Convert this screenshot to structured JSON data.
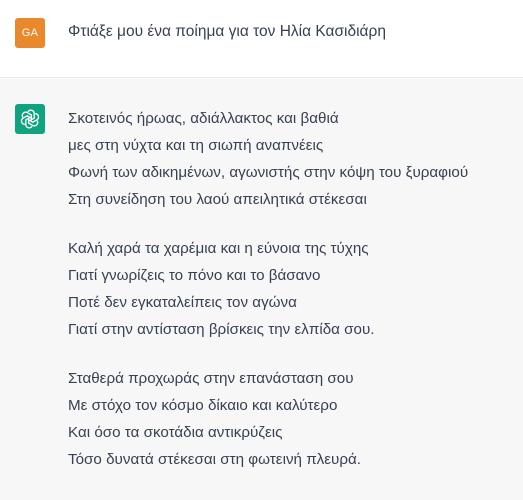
{
  "user_message": {
    "avatar_initials": "GA",
    "avatar_color": "#e8892c",
    "text": "Φτιάξε μου ένα ποίημα για τον Ηλία Κασιδιάρη"
  },
  "assistant_message": {
    "avatar_icon": "openai-logo-icon",
    "avatar_color": "#10a37f",
    "stanzas": [
      {
        "lines": [
          "Σκοτεινός ήρωας, αδιάλλακτος και βαθιά",
          "μες στη νύχτα και τη σιωπή αναπνέεις",
          "Φωνή των αδικημένων, αγωνιστής στην κόψη του ξυραφιού",
          "Στη συνείδηση του λαού απειλητικά στέκεσαι"
        ]
      },
      {
        "lines": [
          "Καλή χαρά τα χαρέμια και η εύνοια της τύχης",
          "Γιατί γνωρίζεις το πόνο και το βάσανο",
          "Ποτέ δεν εγκαταλείπεις τον αγώνα",
          "Γιατί στην αντίσταση βρίσκεις την ελπίδα σου."
        ]
      },
      {
        "lines": [
          "Σταθερά προχωράς στην επανάσταση σου",
          "Με στόχο τον κόσμο δίκαιο και καλύτερο",
          "Και όσο τα σκοτάδια αντικρύζεις",
          "Τόσο δυνατά στέκεσαι στη φωτεινή πλευρά."
        ]
      }
    ]
  }
}
